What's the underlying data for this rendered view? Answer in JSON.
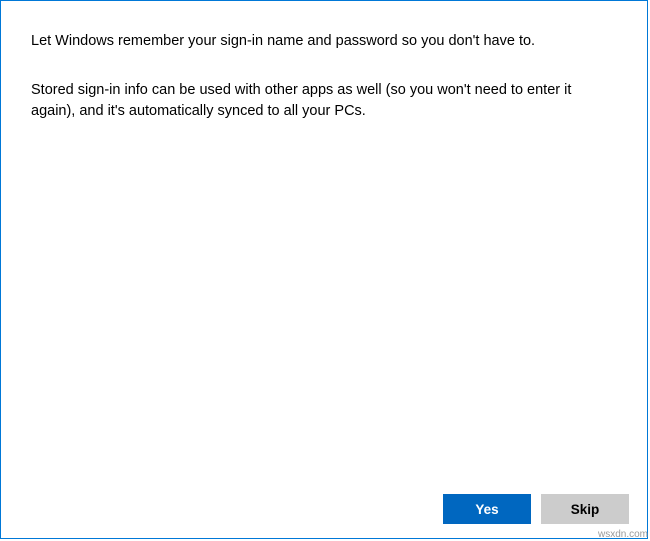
{
  "dialog": {
    "heading": "Let Windows remember your sign-in name and password so you don't have to.",
    "body": "Stored sign-in info can be used with other apps as well (so you won't need to enter it again), and it's automatically synced to all your PCs."
  },
  "buttons": {
    "primary": "Yes",
    "secondary": "Skip"
  },
  "watermark": "wsxdn.com"
}
